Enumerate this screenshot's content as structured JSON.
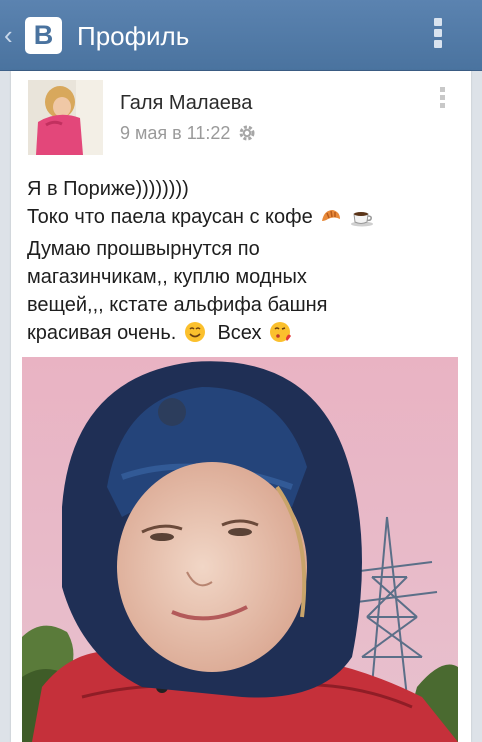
{
  "appbar": {
    "back_label": "‹",
    "logo_letter": "В",
    "title": "Профиль"
  },
  "post": {
    "author": "Галя Малаева",
    "timestamp": "9 мая в 11:22",
    "text_lines": [
      "Я в Пориже))))))))",
      "Токо что паела краусан с кофе",
      "Думаю прошвырнутся по",
      "магазинчикам,, куплю модных",
      "вещей,,, кстате альфифа башня",
      "красивая очень.",
      "Всех"
    ]
  },
  "colors": {
    "appbar": "#4a739f",
    "background": "#dde2e8",
    "card": "#ffffff"
  },
  "icons": [
    "back-chevron-icon",
    "vk-logo",
    "overflow-menu-icon",
    "gear-icon",
    "croissant-emoji",
    "coffee-emoji",
    "smile-emoji",
    "kiss-emoji"
  ]
}
